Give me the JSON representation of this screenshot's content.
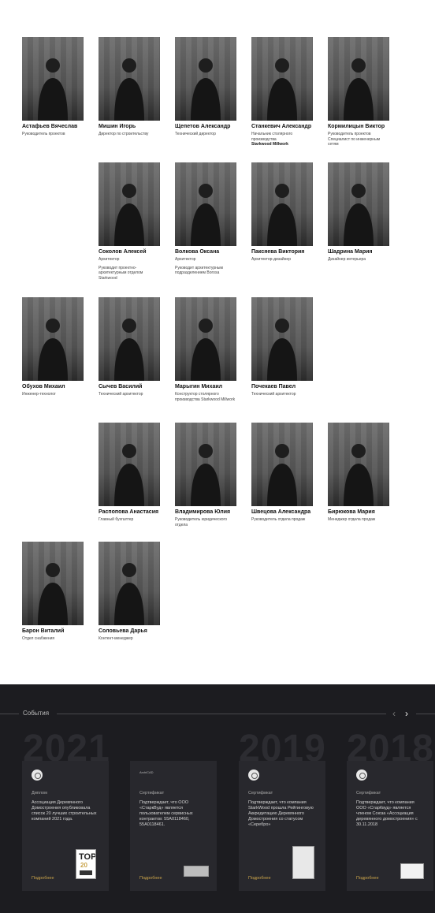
{
  "team": [
    {
      "name": "Астафьев Вячеслав",
      "roles": [
        "Руководитель проектов"
      ]
    },
    {
      "name": "Мишин Игорь",
      "roles": [
        "Директор по строительству"
      ]
    },
    {
      "name": "Щепетов Александр",
      "roles": [
        "Технический директор"
      ]
    },
    {
      "name": "Станкевич Александр",
      "roles": [
        "Начальник столярного производства"
      ],
      "bold_role": "Starkwood Millwork"
    },
    {
      "name": "Кормилицын Виктор",
      "roles": [
        "Руководитель проектов Специалист по инженерным сетям"
      ]
    },
    {
      "name": "Соколов Алексей",
      "roles": [
        "Архитектор",
        "Руководит проектно-архитектурным отделом Starkwood"
      ]
    },
    {
      "name": "Волкова Оксана",
      "roles": [
        "Архитектор",
        "Руководит архитектурным подразделением Borosa"
      ]
    },
    {
      "name": "Паксяева Виктория",
      "roles": [
        "Архитектор-дизайнер"
      ]
    },
    {
      "name": "Шадрина Мария",
      "roles": [
        "Дизайнер интерьера"
      ]
    },
    {
      "name": "Обухов Михаил",
      "roles": [
        "Инженер-технолог"
      ]
    },
    {
      "name": "Сычев Василий",
      "roles": [
        "Технический архитектор"
      ]
    },
    {
      "name": "Марыгин Михаил",
      "roles": [
        "Конструктор столярного производства Starkwood Millwork"
      ]
    },
    {
      "name": "Почекаев Павел",
      "roles": [
        "Технический архитектор"
      ]
    },
    {
      "name": "Распопова Анастасия",
      "roles": [
        "Главный бухгалтер"
      ]
    },
    {
      "name": "Владимирова Юлия",
      "roles": [
        "Руководитель юридического отдела"
      ]
    },
    {
      "name": "Швецова Александра",
      "roles": [
        "Руководитель отдела продаж"
      ]
    },
    {
      "name": "Бирюкова Мария",
      "roles": [
        "Менеджер отдела продаж"
      ]
    },
    {
      "name": "Барон Виталий",
      "roles": [
        "Отдел снабжения"
      ]
    },
    {
      "name": "Соловьева Дарья",
      "roles": [
        "Контент-менеджер"
      ]
    }
  ],
  "events": {
    "title": "События",
    "years": [
      "2021",
      "2019",
      "2018"
    ],
    "cards": [
      {
        "category": "Диплом",
        "description": "Ассоциация Деревянного Домостроения опубликовала список 20 лучших строительных компаний 2021 года.",
        "more": "Подробнее",
        "logo_text": ""
      },
      {
        "category": "Сертификат",
        "description": "Подтверждает, что ООО «СтаркВуд» является пользователем сервисных контрактов: 55А0118460, 55А0118461.",
        "more": "Подробнее",
        "logo_text": "ArchiCAD"
      },
      {
        "category": "Сертификат",
        "description": "Подтверждает, что компания StarkWood прошла Рейтинговую Аккредитацию Деревянного Домостроения со статусом «Серебро»",
        "more": "Подробнее",
        "logo_text": ""
      },
      {
        "category": "Сертификат",
        "description": "Подтверждает, что компания ООО «СтарКвуд» является членом Союза «Ассоциация деревянного домостроения» с 30.11.2018",
        "more": "Подробнее",
        "logo_text": ""
      }
    ]
  },
  "colors": {
    "dark_bg": "#1c1c20",
    "card_bg": "#28282d",
    "accent": "#c9a34a"
  }
}
